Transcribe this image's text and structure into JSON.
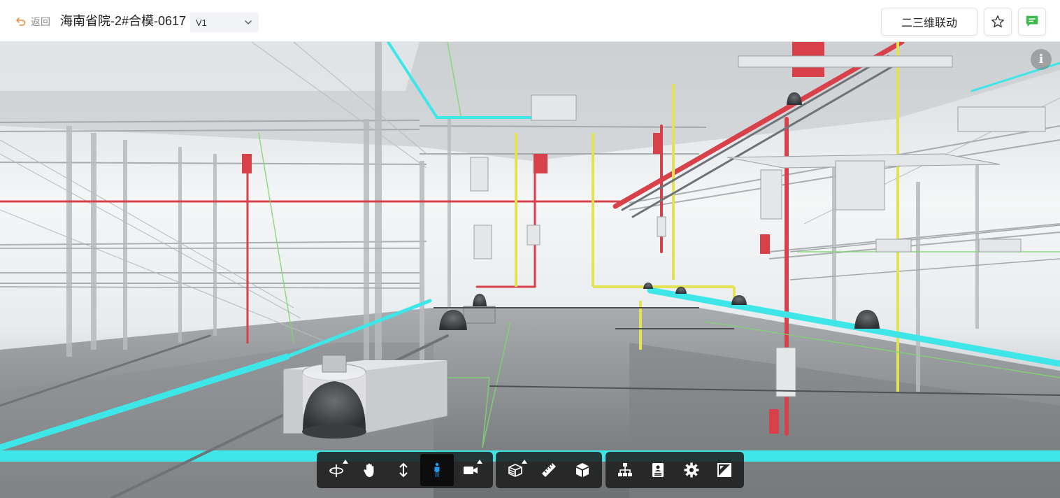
{
  "header": {
    "back_label": "返回",
    "title": "海南省院-2#合模-0617",
    "version": {
      "selected": "V1"
    },
    "linkage_button": "二三维联动"
  },
  "colors": {
    "accent": "#e8903a",
    "comment_icon": "#3fb950",
    "active_tool": "#1e9df0",
    "pipe_cyan": "#3ee6e8",
    "pipe_red": "#d8404a",
    "pipe_yellow": "#e2e254"
  },
  "icons": {
    "back": "return-arrow-icon",
    "version_dropdown": "chevron-down-icon",
    "favorite": "star-icon",
    "comment": "message-icon",
    "info": "info-icon"
  },
  "toolbar": {
    "groups": [
      {
        "tools": [
          {
            "name": "orbit-tool",
            "icon": "orbit-icon",
            "has_menu": true,
            "active": false
          },
          {
            "name": "pan-tool",
            "icon": "hand-icon",
            "has_menu": false,
            "active": false
          },
          {
            "name": "zoom-tool",
            "icon": "vertical-arrows-icon",
            "has_menu": false,
            "active": false
          },
          {
            "name": "walk-tool",
            "icon": "person-icon",
            "has_menu": false,
            "active": true
          },
          {
            "name": "camera-tool",
            "icon": "camera-icon",
            "has_menu": true,
            "active": false
          }
        ]
      },
      {
        "tools": [
          {
            "name": "section-tool",
            "icon": "section-box-icon",
            "has_menu": true,
            "active": false
          },
          {
            "name": "measure-tool",
            "icon": "ruler-icon",
            "has_menu": false,
            "active": false
          },
          {
            "name": "explode-tool",
            "icon": "cube-icon",
            "has_menu": false,
            "active": false
          }
        ]
      },
      {
        "tools": [
          {
            "name": "model-tree-tool",
            "icon": "hierarchy-icon",
            "has_menu": false,
            "active": false
          },
          {
            "name": "properties-tool",
            "icon": "id-card-icon",
            "has_menu": false,
            "active": false
          },
          {
            "name": "settings-tool",
            "icon": "gear-icon",
            "has_menu": false,
            "active": false
          },
          {
            "name": "fullscreen-tool",
            "icon": "fullscreen-icon",
            "has_menu": false,
            "active": false
          }
        ]
      }
    ]
  }
}
